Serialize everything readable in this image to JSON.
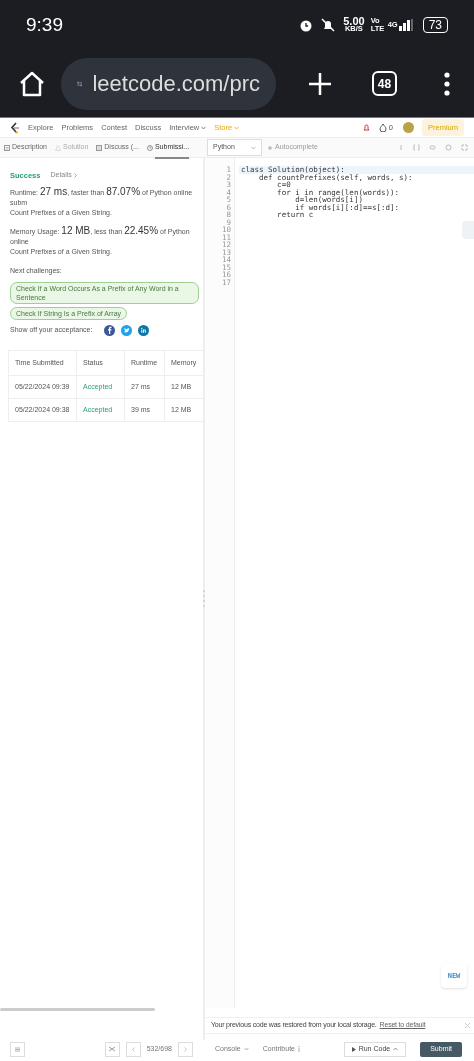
{
  "status_bar": {
    "time": "9:39",
    "net_speed": "5.00",
    "net_unit": "KB/S",
    "volte": "Vo LTE",
    "network": "4G",
    "battery": "73"
  },
  "browser": {
    "url": "leetcode.com/prc",
    "tab_count": "48"
  },
  "nav": {
    "items": [
      {
        "label": "Explore",
        "dropdown": false,
        "highlight": false
      },
      {
        "label": "Problems",
        "dropdown": false,
        "highlight": false
      },
      {
        "label": "Contest",
        "dropdown": false,
        "highlight": false
      },
      {
        "label": "Discuss",
        "dropdown": false,
        "highlight": false
      },
      {
        "label": "Interview",
        "dropdown": true,
        "highlight": false
      },
      {
        "label": "Store",
        "dropdown": true,
        "highlight": true
      }
    ],
    "coins": "0",
    "premium": "Premium"
  },
  "tabs": [
    {
      "label": "Description",
      "selected": false,
      "disabled": false
    },
    {
      "label": "Solution",
      "selected": false,
      "disabled": true
    },
    {
      "label": "Discuss (...",
      "selected": false,
      "disabled": false
    },
    {
      "label": "Submissi...",
      "selected": true,
      "disabled": false
    }
  ],
  "editor_toolbar": {
    "language": "Python",
    "autocomplete": "Autocomplete"
  },
  "result": {
    "status": "Success",
    "details": "Details",
    "runtime": "Runtime: **27 ms**, faster than **87.07%** of Python online subm",
    "runtime_problem": "Count Prefixes of a Given String.",
    "memory": "Memory Usage: **12 MB**, less than **22.45%** of Python online",
    "memory_problem": "Count Prefixes of a Given String.",
    "next_label": "Next challenges:",
    "challenges": [
      "Check If a Word Occurs As a Prefix of Any Word in a Sentence",
      "Check If String Is a Prefix of Array"
    ],
    "share_label": "Show off your acceptance:"
  },
  "table": {
    "columns": [
      "Time Submitted",
      "Status",
      "Runtime",
      "Memory"
    ],
    "rows": [
      [
        "05/22/2024 09:39",
        "Accepted",
        "27 ms",
        "12 MB"
      ],
      [
        "05/22/2024 09:38",
        "Accepted",
        "39 ms",
        "12 MB"
      ]
    ]
  },
  "code": {
    "lines": [
      {
        "number": "1",
        "text": "class Solution(object):"
      },
      {
        "number": "2",
        "text": "    def countPrefixes(self, words, s):"
      },
      {
        "number": "3",
        "text": "        c=0"
      },
      {
        "number": "4",
        "text": "        for i in range(len(words)):"
      },
      {
        "number": "5",
        "text": "            d=len(words[i])"
      },
      {
        "number": "6",
        "text": "            if words[i][:d]==s[:d]:"
      },
      {
        "number": "8",
        "text": "        return c"
      },
      {
        "number": "9"
      },
      {
        "number": "10"
      },
      {
        "number": "11"
      },
      {
        "number": "12"
      },
      {
        "number": "13"
      },
      {
        "number": "14"
      },
      {
        "number": "15"
      },
      {
        "number": "16"
      },
      {
        "number": "17"
      }
    ]
  },
  "new_badge": "NEW",
  "notice": {
    "text": "Your previous code was restored from your local storage.",
    "link": "Reset to default"
  },
  "bottom_bar": {
    "pager": "532/698",
    "console": "Console",
    "contribute": "Contribute",
    "run": "Run Code",
    "submit": "Submit"
  }
}
